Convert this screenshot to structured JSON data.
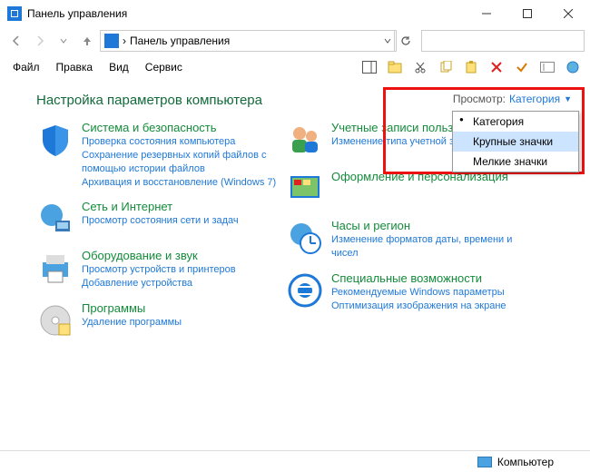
{
  "window": {
    "title": "Панель управления"
  },
  "address": {
    "path": "Панель управления"
  },
  "search": {
    "placeholder": ""
  },
  "menu": {
    "file": "Файл",
    "edit": "Правка",
    "view": "Вид",
    "tools": "Сервис"
  },
  "heading": "Настройка параметров компьютера",
  "viewby": {
    "label": "Просмотр:",
    "value": "Категория"
  },
  "dropdown": {
    "options": [
      {
        "label": "Категория",
        "selected": true,
        "hover": false
      },
      {
        "label": "Крупные значки",
        "selected": false,
        "hover": true
      },
      {
        "label": "Мелкие значки",
        "selected": false,
        "hover": false
      }
    ]
  },
  "left": [
    {
      "title": "Система и безопасность",
      "links": [
        "Проверка состояния компьютера",
        "Сохранение резервных копий файлов с помощью истории файлов",
        "Архивация и восстановление (Windows 7)"
      ]
    },
    {
      "title": "Сеть и Интернет",
      "links": [
        "Просмотр состояния сети и задач"
      ]
    },
    {
      "title": "Оборудование и звук",
      "links": [
        "Просмотр устройств и принтеров",
        "Добавление устройства"
      ]
    },
    {
      "title": "Программы",
      "links": [
        "Удаление программы"
      ]
    }
  ],
  "right": [
    {
      "title": "Учетные записи польз",
      "links": [
        "Изменение типа учетной за"
      ]
    },
    {
      "title": "Оформление и персонализация",
      "links": []
    },
    {
      "title": "Часы и регион",
      "links": [
        "Изменение форматов даты, времени и чисел"
      ]
    },
    {
      "title": "Специальные возможности",
      "links": [
        "Рекомендуемые Windows параметры",
        "Оптимизация изображения на экране"
      ]
    }
  ],
  "status": {
    "text": "Компьютер"
  }
}
